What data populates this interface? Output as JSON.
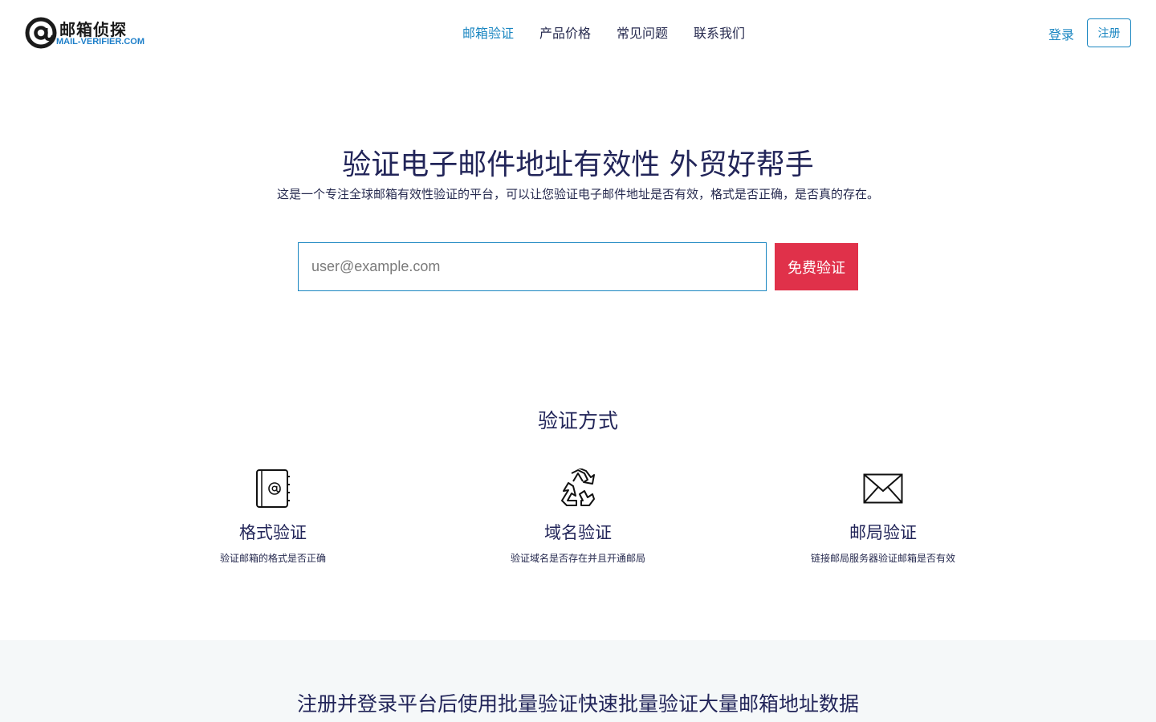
{
  "logo": {
    "title": "邮箱侦探",
    "subtitle": "MAIL-VERIFIER.COM",
    "icon": "at-sign-icon"
  },
  "nav": {
    "items": [
      {
        "label": "邮箱验证",
        "active": true
      },
      {
        "label": "产品价格",
        "active": false
      },
      {
        "label": "常见问题",
        "active": false
      },
      {
        "label": "联系我们",
        "active": false
      }
    ],
    "login_label": "登录",
    "register_label": "注册"
  },
  "hero": {
    "title": "验证电子邮件地址有效性 外贸好帮手",
    "description": "这是一个专注全球邮箱有效性验证的平台，可以让您验证电子邮件地址是否有效，格式是否正确，是否真的存在。",
    "input_placeholder": "user@example.com",
    "button_label": "免费验证"
  },
  "methods": {
    "title": "验证方式",
    "items": [
      {
        "icon": "address-book-icon",
        "title": "格式验证",
        "description": "验证邮箱的格式是否正确"
      },
      {
        "icon": "recycle-icon",
        "title": "域名验证",
        "description": "验证域名是否存在并且开通邮局"
      },
      {
        "icon": "envelope-icon",
        "title": "邮局验证",
        "description": "链接邮局服务器验证邮箱是否有效"
      }
    ]
  },
  "band": {
    "title": "注册并登录平台后使用批量验证快速批量验证大量邮箱地址数据"
  },
  "colors": {
    "accent": "#1a86c1",
    "cta": "#e0314a",
    "heading": "#222559",
    "band_background": "#f5f8f9"
  }
}
